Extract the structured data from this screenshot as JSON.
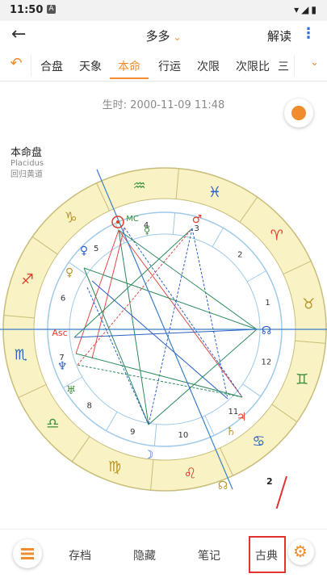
{
  "statusbar": {
    "time": "11:50",
    "notif_icon": "A",
    "system_icons": "▾◢▮"
  },
  "appbar": {
    "title": "多多",
    "interpret_label": "解读",
    "more_label": "⋮",
    "back_label": "←",
    "dropdown_glyph": "⌄"
  },
  "tabs": {
    "undo_label": "↶",
    "items": [
      {
        "label": "合盘"
      },
      {
        "label": "天象"
      },
      {
        "label": "本命"
      },
      {
        "label": "行运"
      },
      {
        "label": "次限"
      },
      {
        "label": "次限比"
      },
      {
        "label": "三"
      }
    ],
    "active": "本命",
    "more_label": "⌄"
  },
  "birth_time": "生时: 2000-11-09 11:48",
  "chart": {
    "title": "本命盘",
    "system": "Placidus",
    "zodiac": "回归黄道",
    "house_numbers": [
      "1",
      "2",
      "3",
      "4",
      "5",
      "6",
      "7",
      "8",
      "9",
      "10",
      "11",
      "12"
    ],
    "signs": [
      "♈",
      "♉",
      "♊",
      "♋",
      "♌",
      "♍",
      "♎",
      "♏",
      "♐",
      "♑",
      "♒",
      "♓"
    ],
    "asc_label": "Asc",
    "mc_label": "MC",
    "colors": {
      "outer_ring": "#f8f2c4",
      "sign_fire": "#e03c2c",
      "sign_earth": "#b8962e",
      "sign_air": "#3c8f3c",
      "sign_water": "#2c5fc8",
      "accent": "#f08c2c"
    }
  },
  "annotation": {
    "step_label": "2"
  },
  "bottombar": {
    "archive_label": "存档",
    "hide_label": "隐藏",
    "notes_label": "笔记",
    "classic_label": "古典"
  }
}
